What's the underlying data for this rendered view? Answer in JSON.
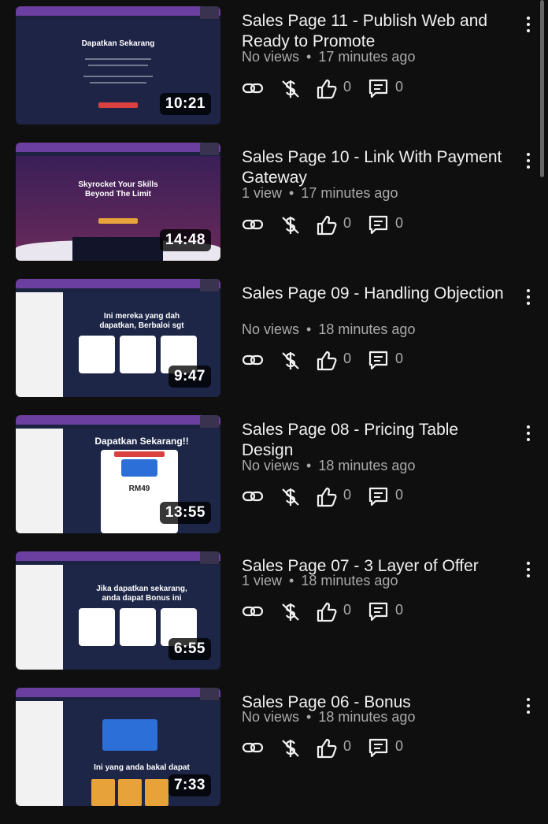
{
  "videos": [
    {
      "title": "Sales Page 11 - Publish Web and Ready to Promote",
      "views": "No views",
      "age": "17 minutes ago",
      "duration": "10:21",
      "likes": "0",
      "comments": "0",
      "thumb": {
        "style": "dark",
        "heading": "Dapatkan Sekarang"
      }
    },
    {
      "title": "Sales Page 10 - Link With Payment Gateway",
      "views": "1 view",
      "age": "17 minutes ago",
      "duration": "14:48",
      "likes": "0",
      "comments": "0",
      "thumb": {
        "style": "purple",
        "heading": "Skyrocket Your Skills Beyond The Limit"
      }
    },
    {
      "title": "Sales Page 09 - Handling Objection",
      "views": "No views",
      "age": "18 minutes ago",
      "duration": "9:47",
      "likes": "0",
      "comments": "0",
      "thumb": {
        "style": "editor",
        "heading": "Ini mereka yang dah dapatkan, Berbaloi sgt"
      }
    },
    {
      "title": "Sales Page 08 - Pricing Table Design",
      "views": "No views",
      "age": "18 minutes ago",
      "duration": "13:55",
      "likes": "0",
      "comments": "0",
      "thumb": {
        "style": "pricing",
        "heading": "Dapatkan Sekarang!!",
        "price": "RM49"
      }
    },
    {
      "title": "Sales Page 07 - 3 Layer of Offer",
      "views": "1 view",
      "age": "18 minutes ago",
      "duration": "6:55",
      "likes": "0",
      "comments": "0",
      "thumb": {
        "style": "editor",
        "heading": "Jika dapatkan sekarang, anda dapat Bonus ini"
      }
    },
    {
      "title": "Sales Page 06 - Bonus",
      "views": "No views",
      "age": "18 minutes ago",
      "duration": "7:33",
      "likes": "0",
      "comments": "0",
      "thumb": {
        "style": "bonus",
        "heading": "Ini yang anda bakal dapat"
      }
    }
  ],
  "separator": "•",
  "colors": {
    "background": "#0f0f0f",
    "primary_text": "#f1f1f1",
    "secondary_text": "#aaaaaa"
  },
  "icons": [
    "link-icon",
    "no-monetization-icon",
    "like-icon",
    "comments-icon",
    "more-vert-icon"
  ]
}
